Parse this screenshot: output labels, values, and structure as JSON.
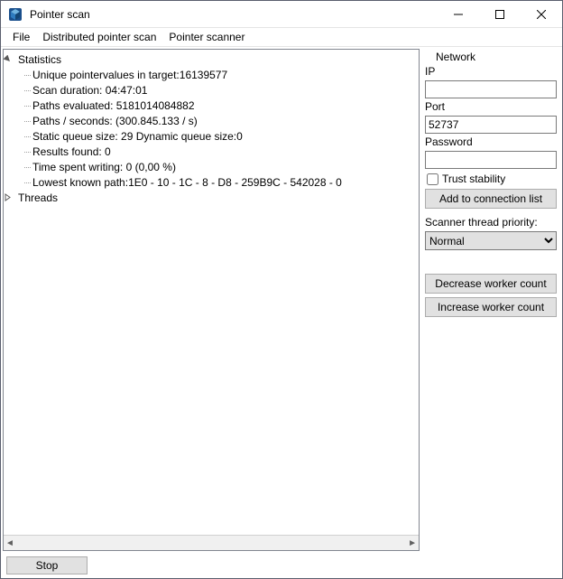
{
  "window": {
    "title": "Pointer scan"
  },
  "menu": {
    "file": "File",
    "dps": "Distributed pointer scan",
    "pscan": "Pointer scanner"
  },
  "tree": {
    "statistics_label": "Statistics",
    "stats": {
      "unique": "Unique pointervalues in target:16139577",
      "duration": "Scan duration: 04:47:01",
      "paths_eval": "Paths evaluated: 5181014084882",
      "paths_sec": "Paths / seconds: (300.845.133 / s)",
      "queue": "Static queue size: 29 Dynamic queue size:0",
      "results": "Results found: 0",
      "writing": "Time spent writing: 0 (0,00 %)",
      "lowest": "Lowest known path:1E0 - 10 - 1C - 8 - D8 - 259B9C - 542028 - 0"
    },
    "threads_label": "Threads"
  },
  "side": {
    "network_label": "Network",
    "ip_label": "IP",
    "ip_value": "",
    "port_label": "Port",
    "port_value": "52737",
    "password_label": "Password",
    "password_value": "",
    "trust_label": "Trust stability",
    "add_conn": "Add to connection list",
    "priority_label": "Scanner thread priority:",
    "priority_value": "Normal",
    "dec_worker": "Decrease worker count",
    "inc_worker": "Increase worker count"
  },
  "buttons": {
    "stop": "Stop"
  }
}
